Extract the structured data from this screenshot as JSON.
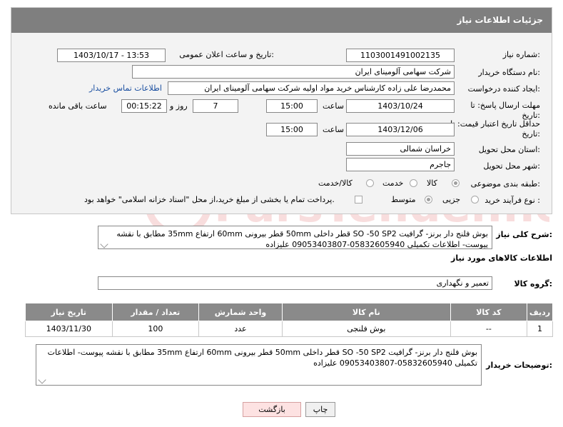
{
  "panel": {
    "title": "جزئیات اطلاعات نیاز"
  },
  "fields": {
    "need_number_label": "شماره نیاز:",
    "need_number": "1103001491002135",
    "announce_label": "تاریخ و ساعت اعلان عمومی:",
    "announce_value": "1403/10/17 - 13:53",
    "buyer_org_label": "نام دستگاه خریدار:",
    "buyer_org": "شرکت سهامی آلومینای ایران",
    "creator_label": "ایجاد کننده درخواست:",
    "creator": "محمدرضا علی زاده کارشناس خرید مواد اولیه شرکت سهامی آلومینای ایران",
    "contact_link": "اطلاعات تماس خریدار",
    "deadline_label_1": "مهلت ارسال پاسخ: تا",
    "deadline_label_2": "تاریخ:",
    "deadline_date": "1403/10/24",
    "time_label": "ساعت",
    "deadline_time": "15:00",
    "days_value": "7",
    "days_label": "روز و",
    "remaining_time": "00:15:22",
    "remaining_label": "ساعت باقی مانده",
    "validity_label_1": "حداقل تاریخ اعتبار قیمت: تا",
    "validity_label_2": "تاریخ:",
    "validity_date": "1403/12/06",
    "validity_time_label": "ساعت",
    "validity_time": "15:00",
    "province_label": "استان محل تحویل:",
    "province": "خراسان شمالی",
    "city_label": "شهر محل تحویل:",
    "city": "جاجرم",
    "category_label": "طبقه بندی موضوعی:",
    "category_options": [
      "کالا",
      "خدمت",
      "کالا/خدمت"
    ],
    "process_label": "نوع فرآیند خرید :",
    "process_options": [
      "جزیی",
      "متوسط"
    ],
    "payment_note": "پرداخت تمام یا بخشی از مبلغ خرید،از محل \"اسناد خزانه اسلامی\" خواهد بود."
  },
  "description": {
    "label": "شرح کلی نیاز:",
    "text": "بوش فلنج دار برنز- گرافیت SO -50 SP2 قطر داخلی 50mm قطر بیرونی 60mm ارتفاع 35mm مطابق با نقشه پیوست- اطلاعات تکمیلی 05832605940-09053403807 علیزاده"
  },
  "goods": {
    "section_title": "اطلاعات کالاهای مورد نیاز",
    "group_label": "گروه کالا:",
    "group_value": "تعمیر و نگهداری",
    "columns": [
      "ردیف",
      "کد کالا",
      "نام کالا",
      "واحد شمارش",
      "تعداد / مقدار",
      "تاریخ نیاز"
    ],
    "rows": [
      [
        "1",
        "--",
        "بوش فلنجی",
        "عدد",
        "100",
        "1403/11/30"
      ]
    ]
  },
  "buyer_notes": {
    "label": "توضیحات خریدار:",
    "text": "بوش فلنج دار برنز- گرافیت SO -50 SP2 قطر داخلی 50mm قطر بیرونی 60mm ارتفاع 35mm مطابق با نقشه پیوست- اطلاعات تکمیلی 05832605940-09053403807 علیزاده"
  },
  "buttons": {
    "print": "چاپ",
    "back": "بازگشت"
  },
  "watermark_text": "ParsTender.net",
  "colors": {
    "header_bg": "#7f7f7f",
    "table_header_bg": "#8a8a8a",
    "link": "#1a4fa0",
    "back_button_bg": "#fde2e2"
  }
}
